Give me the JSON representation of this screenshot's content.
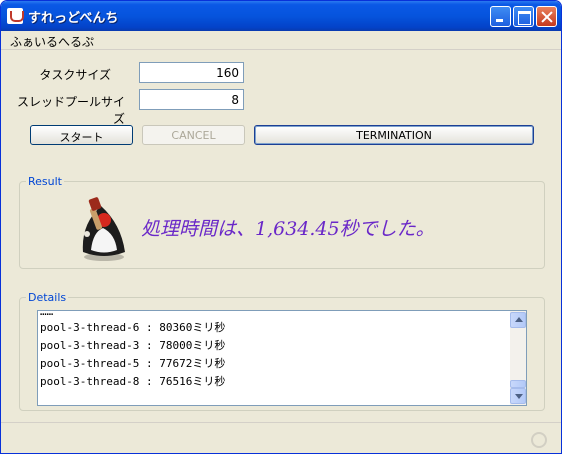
{
  "window": {
    "title": "すれっどべんち"
  },
  "menu": {
    "file": "ふぁいる",
    "help": "へるぷ"
  },
  "form": {
    "task_size_label": "タスクサイズ",
    "task_size_value": "160",
    "pool_size_label": "スレッドプールサイズ",
    "pool_size_value": "8"
  },
  "buttons": {
    "start": "スタート",
    "cancel": "CANCEL",
    "termination": "TERMINATION"
  },
  "result": {
    "group_title": "Result",
    "message": "処理時間は、1,634.45秒でした。"
  },
  "details": {
    "group_title": "Details",
    "lines": [
      "pool-3-thread-6 : 80360ミリ秒",
      "pool-3-thread-3 : 78000ミリ秒",
      "pool-3-thread-5 : 77672ミリ秒",
      "pool-3-thread-8 : 76516ミリ秒"
    ]
  },
  "colors": {
    "titlebar": "#0654dd",
    "window_bg": "#ece9d8",
    "result_text": "#6a28c8",
    "group_title": "#0046d5"
  }
}
